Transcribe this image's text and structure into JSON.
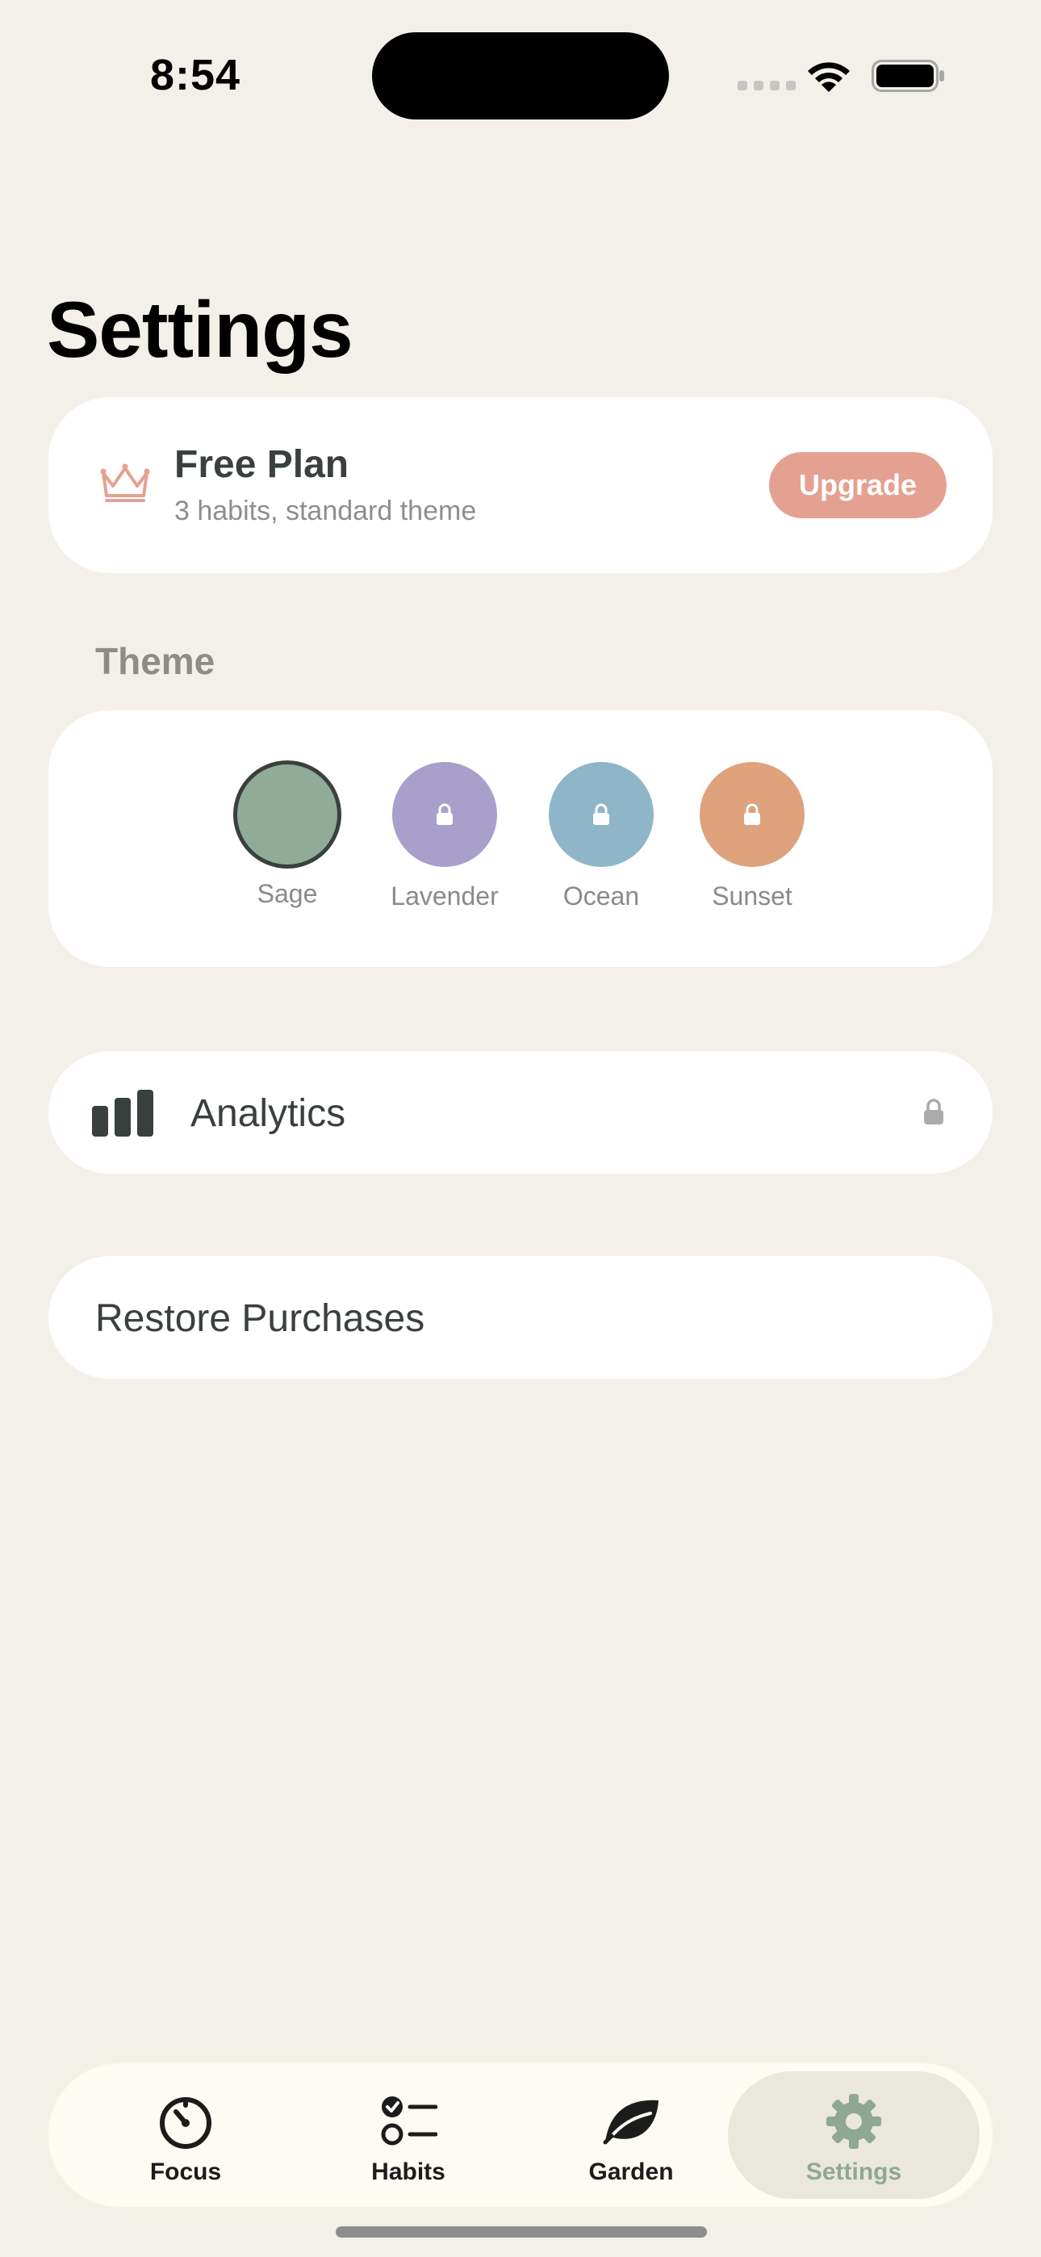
{
  "status_bar": {
    "time": "8:54"
  },
  "page": {
    "title": "Settings"
  },
  "plan": {
    "title": "Free Plan",
    "subtitle": "3 habits, standard theme",
    "upgrade_label": "Upgrade",
    "accent_color": "#E4A192"
  },
  "theme_section": {
    "label": "Theme",
    "swatches": [
      {
        "name": "Sage",
        "color": "#91AB99",
        "selected": true,
        "locked": false
      },
      {
        "name": "Lavender",
        "color": "#A99FCB",
        "selected": false,
        "locked": true
      },
      {
        "name": "Ocean",
        "color": "#8FB5C8",
        "selected": false,
        "locked": true
      },
      {
        "name": "Sunset",
        "color": "#DEA27D",
        "selected": false,
        "locked": true
      }
    ]
  },
  "analytics": {
    "label": "Analytics",
    "locked": true,
    "icon": "bar-chart-icon"
  },
  "restore": {
    "label": "Restore Purchases"
  },
  "tabbar": {
    "tabs": [
      {
        "label": "Focus",
        "icon": "timer-icon",
        "active": false
      },
      {
        "label": "Habits",
        "icon": "checklist-icon",
        "active": false
      },
      {
        "label": "Garden",
        "icon": "leaf-icon",
        "active": false
      },
      {
        "label": "Settings",
        "icon": "gear-icon",
        "active": true
      }
    ],
    "active_color": "#8FA893"
  }
}
